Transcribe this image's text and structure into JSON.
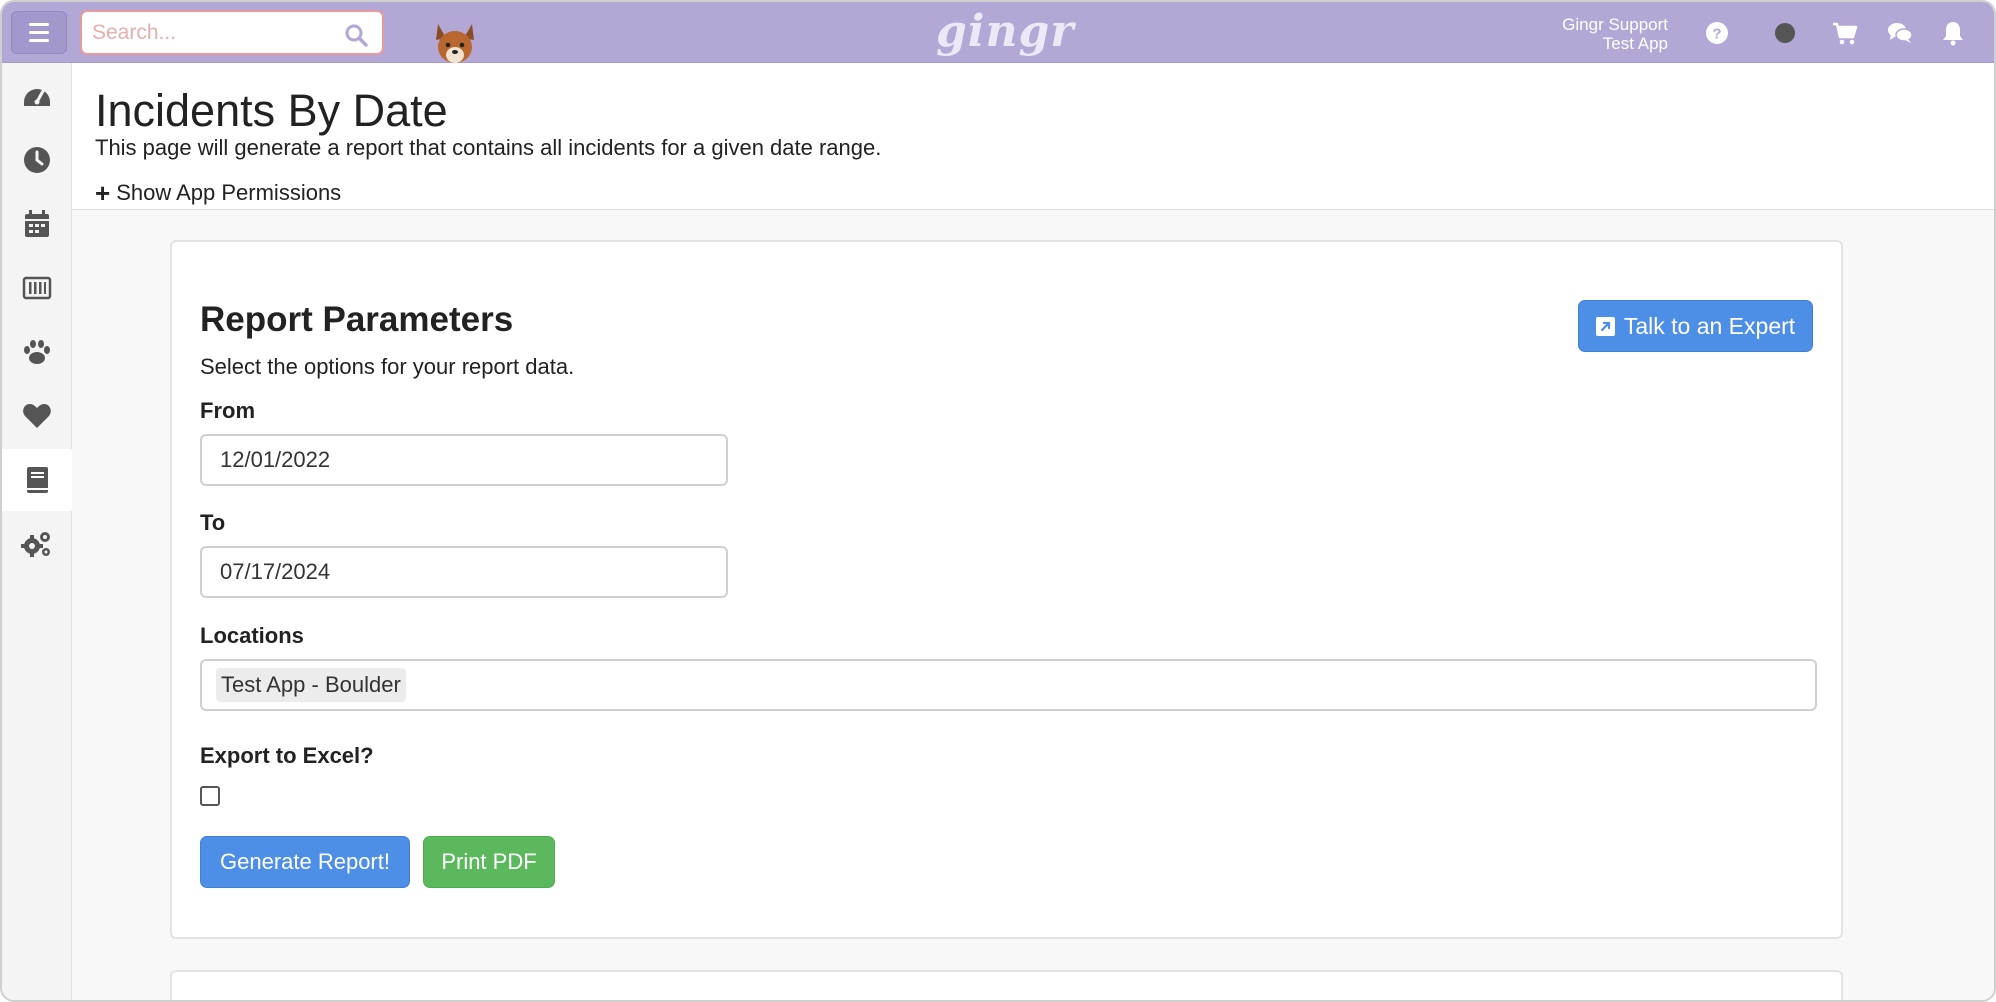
{
  "topbar": {
    "search_placeholder": "Search...",
    "logo": "gingr",
    "user_name": "Gingr Support",
    "app_name": "Test App"
  },
  "page": {
    "title": "Incidents By Date",
    "description": "This page will generate a report that contains all incidents for a given date range.",
    "permissions_link": "Show App Permissions"
  },
  "report": {
    "title": "Report Parameters",
    "subtitle": "Select the options for your report data.",
    "expert_button": "Talk to an Expert",
    "from_label": "From",
    "from_value": "12/01/2022",
    "to_label": "To",
    "to_value": "07/17/2024",
    "locations_label": "Locations",
    "location_tag": "Test App - Boulder",
    "export_label": "Export to Excel?",
    "export_checked": false,
    "generate_button": "Generate Report!",
    "print_button": "Print PDF"
  },
  "sidebar": {
    "items": [
      {
        "icon": "dashboard-icon"
      },
      {
        "icon": "clock-icon"
      },
      {
        "icon": "calendar-icon"
      },
      {
        "icon": "barcode-icon"
      },
      {
        "icon": "paw-icon"
      },
      {
        "icon": "heart-icon"
      },
      {
        "icon": "book-icon",
        "active": true
      },
      {
        "icon": "gears-icon"
      }
    ]
  },
  "colors": {
    "topbar": "#b3a7d6",
    "primary": "#4d8ee6",
    "success": "#5cb85c"
  }
}
